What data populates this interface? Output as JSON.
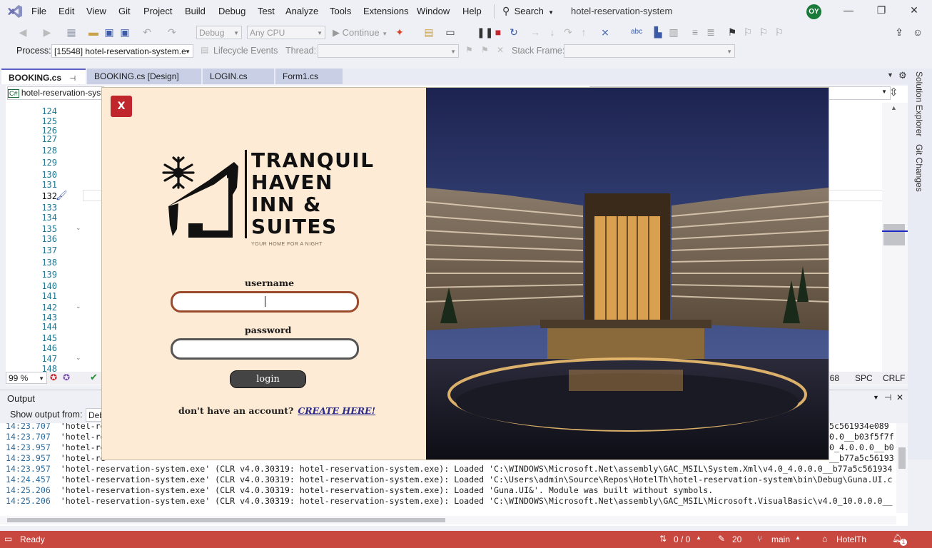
{
  "menubar": {
    "items": [
      "File",
      "Edit",
      "View",
      "Git",
      "Project",
      "Build",
      "Debug",
      "Test",
      "Analyze",
      "Tools",
      "Extensions",
      "Window",
      "Help"
    ],
    "search_label": "Search",
    "solution_name": "hotel-reservation-system",
    "user_initials": "OY"
  },
  "toolbar": {
    "config": "Debug",
    "platform": "Any CPU",
    "continue_label": "Continue",
    "process_label": "Process:",
    "process_value": "[15548] hotel-reservation-system.e",
    "lifecycle_label": "Lifecycle Events",
    "thread_label": "Thread:",
    "stackframe_label": "Stack Frame:"
  },
  "tabs": [
    "BOOKING.cs",
    "BOOKING.cs [Design]",
    "LOGIN.cs",
    "Form1.cs"
  ],
  "editor": {
    "nav_dropdown": "hotel-reservation-syst",
    "line_numbers": [
      "124",
      "125",
      "126",
      "127",
      "128",
      "129",
      "130",
      "131",
      "132",
      "133",
      "134",
      "135",
      "136",
      "137",
      "138",
      "139",
      "140",
      "141",
      "142",
      "143",
      "144",
      "145",
      "146",
      "147",
      "148"
    ],
    "zoom": "99 %",
    "position": ": 68",
    "spacing": "SPC",
    "line_ending": "CRLF"
  },
  "side_panel": {
    "solution_explorer": "Solution Explorer",
    "git_changes": "Git Changes"
  },
  "output": {
    "title": "Output",
    "show_from_label": "Show output from:",
    "show_from_value": "Deb",
    "lines": [
      {
        "time": "14:23.707",
        "text": "'hotel-re",
        "tail": "5c561934e089"
      },
      {
        "time": "14:23.707",
        "text": "'hotel-re",
        "tail": "0.0__b03f5f7f"
      },
      {
        "time": "14:23.957",
        "text": "'hotel-re",
        "tail": "0_4.0.0.0__b0"
      },
      {
        "time": "14:23.957",
        "text": "'hotel-re",
        "tail": "__b77a5c56193"
      },
      {
        "time": "14:23.957",
        "text": "'hotel-reservation-system.exe' (CLR v4.0.30319: hotel-reservation-system.exe): Loaded 'C:\\WINDOWS\\Microsoft.Net\\assembly\\GAC_MSIL\\System.Xml\\v4.0_4.0.0.0__b77a5c561934",
        "tail": ""
      },
      {
        "time": "14:24.457",
        "text": "'hotel-reservation-system.exe' (CLR v4.0.30319: hotel-reservation-system.exe): Loaded 'C:\\Users\\admin\\Source\\Repos\\HotelTh\\hotel-reservation-system\\bin\\Debug\\Guna.UI.c",
        "tail": ""
      },
      {
        "time": "14:25.206",
        "text": "'hotel-reservation-system.exe' (CLR v4.0.30319: hotel-reservation-system.exe): Loaded 'Guna.UI&'. Module was built without symbols.",
        "tail": ""
      },
      {
        "time": "14:25.206",
        "text": "'hotel-reservation-system.exe' (CLR v4.0.30319: hotel-reservation-system.exe): Loaded 'C:\\WINDOWS\\Microsoft.Net\\assembly\\GAC_MSIL\\Microsoft.VisualBasic\\v4.0_10.0.0.0__",
        "tail": ""
      }
    ]
  },
  "statusbar": {
    "ready": "Ready",
    "errors": "0 / 0",
    "edits": "20",
    "branch": "main",
    "repo": "HotelTh",
    "notifications": "1"
  },
  "login": {
    "close_label": "X",
    "brand_lines": [
      "TRANQUIL",
      "HAVEN",
      "INN &",
      "SUITES"
    ],
    "tagline": "YOUR HOME FOR A NIGHT",
    "username_label": "username",
    "username_value": "",
    "password_label": "password",
    "password_value": "",
    "login_button": "login",
    "signup_prompt": "don't have an account?",
    "signup_link": "CREATE HERE!"
  },
  "colors": {
    "form_bg": "#feebd5",
    "close_red": "#c0272d",
    "username_border": "#9b4a2e",
    "statusbar_red": "#c8473f",
    "accent_tab": "#5b60c4"
  }
}
